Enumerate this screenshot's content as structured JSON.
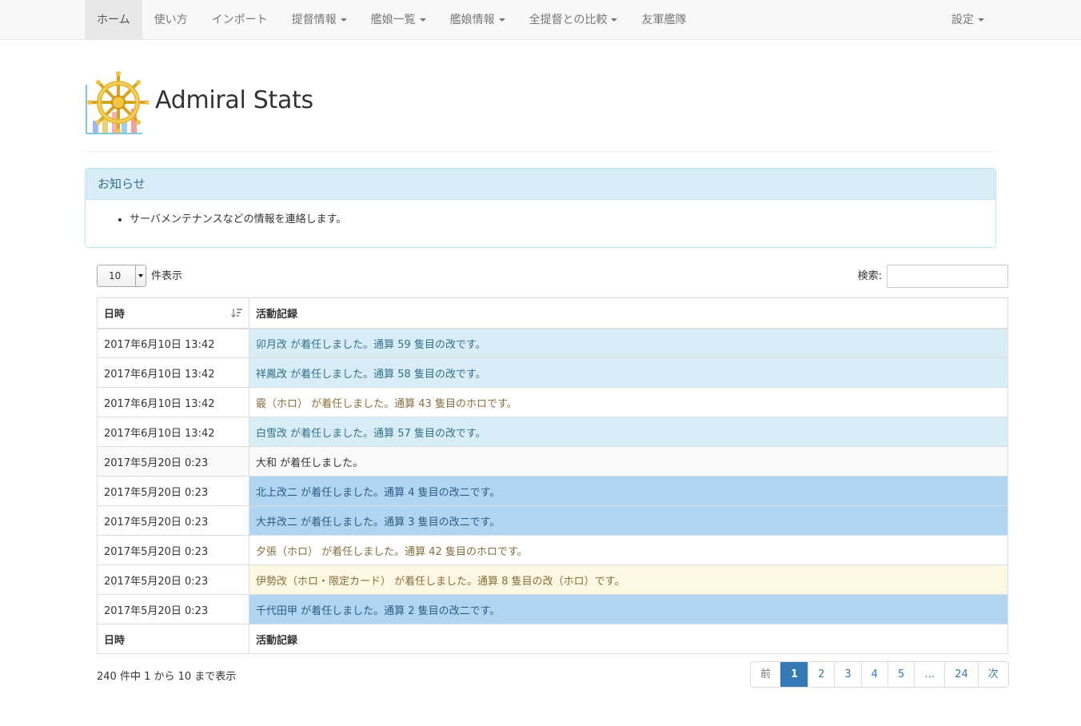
{
  "nav": {
    "items": [
      {
        "label": "ホーム",
        "active": true,
        "caret": false
      },
      {
        "label": "使い方",
        "caret": false
      },
      {
        "label": "インポート",
        "caret": false
      },
      {
        "label": "提督情報",
        "caret": true
      },
      {
        "label": "艦娘一覧",
        "caret": true
      },
      {
        "label": "艦娘情報",
        "caret": true
      },
      {
        "label": "全提督との比較",
        "caret": true
      },
      {
        "label": "友軍艦隊",
        "caret": false
      }
    ],
    "settings_label": "設定"
  },
  "header": {
    "title": "Admiral Stats"
  },
  "notice": {
    "heading": "お知らせ",
    "items": [
      "サーバメンテナンスなどの情報を連絡します。"
    ]
  },
  "controls": {
    "length_value": "10",
    "length_suffix": "件表示",
    "search_label": "検索:",
    "search_value": ""
  },
  "table": {
    "headers": [
      "日時",
      "活動記録"
    ],
    "rows": [
      {
        "time": "2017年6月10日 13:42",
        "record": "卯月改 が着任しました。通算 59 隻目の改です。",
        "style": "info"
      },
      {
        "time": "2017年6月10日 13:42",
        "record": "祥鳳改 が着任しました。通算 58 隻目の改です。",
        "style": "info"
      },
      {
        "time": "2017年6月10日 13:42",
        "record": "霰（ホロ） が着任しました。通算 43 隻目のホロです。",
        "style": "plain"
      },
      {
        "time": "2017年6月10日 13:42",
        "record": "白雪改 が着任しました。通算 57 隻目の改です。",
        "style": "info"
      },
      {
        "time": "2017年5月20日 0:23",
        "record": "大和 が着任しました。",
        "style": "striped"
      },
      {
        "time": "2017年5月20日 0:23",
        "record": "北上改二 が着任しました。通算 4 隻目の改二です。",
        "style": "primary"
      },
      {
        "time": "2017年5月20日 0:23",
        "record": "大井改二 が着任しました。通算 3 隻目の改二です。",
        "style": "primary"
      },
      {
        "time": "2017年5月20日 0:23",
        "record": "夕張（ホロ） が着任しました。通算 42 隻目のホロです。",
        "style": "plain"
      },
      {
        "time": "2017年5月20日 0:23",
        "record": "伊勢改（ホロ・限定カード） が着任しました。通算 8 隻目の改（ホロ）です。",
        "style": "warning"
      },
      {
        "time": "2017年5月20日 0:23",
        "record": "千代田甲 が着任しました。通算 2 隻目の改二です。",
        "style": "primary"
      }
    ]
  },
  "footer": {
    "info": "240 件中 1 から 10 まで表示",
    "pages": [
      "前",
      "1",
      "2",
      "3",
      "4",
      "5",
      "…",
      "24",
      "次"
    ],
    "active_page": "1"
  },
  "colors": {
    "info_bg": "#d9edf7",
    "primary_bg": "#b0d5f3",
    "warning_bg": "#fcf8e3",
    "link": "#337ab7"
  }
}
